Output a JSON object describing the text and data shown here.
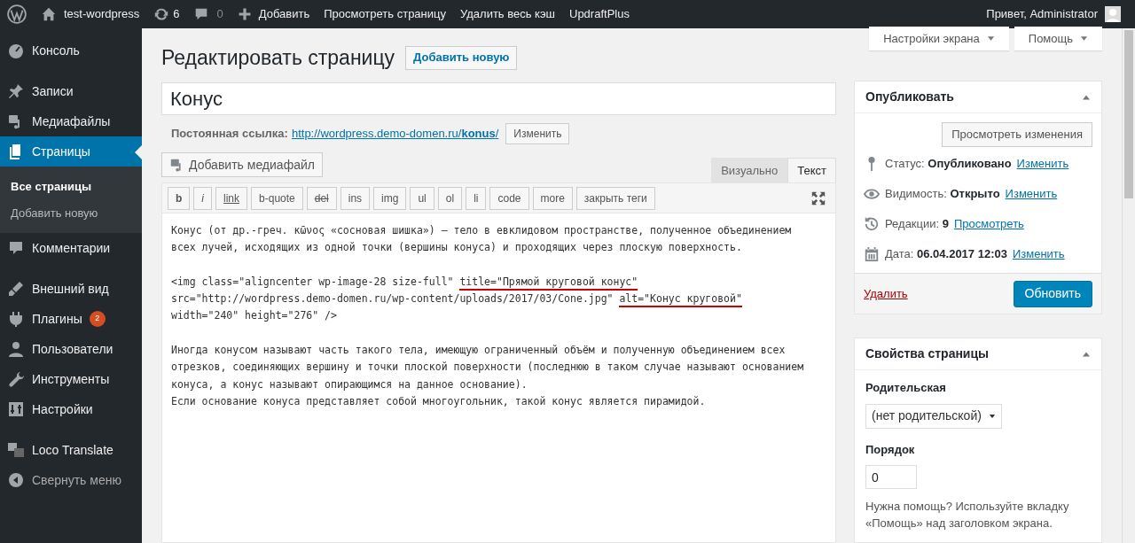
{
  "admin_bar": {
    "site": "test-wordpress",
    "updates": "6",
    "comments": "0",
    "items": [
      "Добавить",
      "Просмотреть страницу",
      "Удалить весь кэш",
      "UpdraftPlus"
    ],
    "greeting": "Привет, Administrator"
  },
  "sidebar": {
    "items": [
      {
        "label": "Консоль",
        "selected": false
      },
      {
        "label": "Записи",
        "selected": false
      },
      {
        "label": "Медиафайлы",
        "selected": false
      },
      {
        "label": "Страницы",
        "selected": true,
        "children": [
          {
            "label": "Все страницы",
            "selected": true
          },
          {
            "label": "Добавить новую",
            "selected": false
          }
        ]
      },
      {
        "label": "Комментарии",
        "selected": false
      },
      {
        "label": "Внешний вид",
        "selected": false
      },
      {
        "label": "Плагины",
        "selected": false,
        "badge": "2"
      },
      {
        "label": "Пользователи",
        "selected": false
      },
      {
        "label": "Инструменты",
        "selected": false
      },
      {
        "label": "Настройки",
        "selected": false
      },
      {
        "label": "Loco Translate",
        "selected": false
      },
      {
        "label": "Свернуть меню",
        "selected": false
      }
    ]
  },
  "screen_meta": [
    "Настройки экрана",
    "Помощь"
  ],
  "heading": {
    "title": "Редактировать страницу",
    "add_new": "Добавить новую"
  },
  "post_title": "Конус",
  "permalink": {
    "label": "Постоянная ссылка:",
    "url_start": "http://wordpress.demo-domen.ru/",
    "slug": "konus",
    "url_end": "/",
    "button": "Изменить"
  },
  "add_media": "Добавить медиафайл",
  "tabs": [
    {
      "label": "Визуально",
      "selected": false
    },
    {
      "label": "Текст",
      "selected": true
    }
  ],
  "quicktags": [
    {
      "label": "b",
      "kind": "bold"
    },
    {
      "label": "i",
      "kind": "italic"
    },
    {
      "label": "link",
      "kind": "underline"
    },
    {
      "label": "b-quote",
      "kind": "plain"
    },
    {
      "label": "del",
      "kind": "strike"
    },
    {
      "label": "ins",
      "kind": "plain"
    },
    {
      "label": "img",
      "kind": "plain"
    },
    {
      "label": "ul",
      "kind": "plain"
    },
    {
      "label": "ol",
      "kind": "plain"
    },
    {
      "label": "li",
      "kind": "plain"
    },
    {
      "label": "code",
      "kind": "plain"
    },
    {
      "label": "more",
      "kind": "plain"
    },
    {
      "label": "закрыть теги",
      "kind": "plain"
    }
  ],
  "editor": {
    "paragraphs": [
      [
        [
          {
            "text": "Конус (от др.-греч. κῶνος «сосновая шишка») — тело в евклидовом пространстве, полученное объединением",
            "marked": false
          }
        ],
        [
          {
            "text": "всех лучей, исходящих из одной точки (вершины конуса) и проходящих через плоскую поверхность.",
            "marked": false
          }
        ]
      ],
      [
        [
          {
            "text": "<img class=\"aligncenter wp-image-28 size-full\" ",
            "marked": false
          },
          {
            "text": "title=\"Прямой круговой конус\"",
            "marked": true
          }
        ],
        [
          {
            "text": "src=\"http://wordpress.demo-domen.ru/wp-content/uploads/2017/03/Cone.jpg\" ",
            "marked": false
          },
          {
            "text": "alt=\"Конус круговой\"",
            "marked": true
          }
        ],
        [
          {
            "text": "width=\"240\" height=\"276\" />",
            "marked": false
          }
        ]
      ],
      [
        [
          {
            "text": "Иногда конусом называют часть такого тела, имеющую ограниченный объём и полученную объединением всех",
            "marked": false
          }
        ],
        [
          {
            "text": "отрезков, соединяющих вершину и точки плоской поверхности (последнюю в таком случае называют основанием",
            "marked": false
          }
        ],
        [
          {
            "text": "конуса, а конус называют опирающимся на данное основание).",
            "marked": false
          }
        ],
        [
          {
            "text": "Если основание конуса представляет собой многоугольник, такой конус является пирамидой.",
            "marked": false
          }
        ]
      ]
    ]
  },
  "publish": {
    "title": "Опубликовать",
    "preview": "Просмотреть изменения",
    "rows": [
      {
        "label": "Статус:",
        "value": "Опубликовано",
        "link": "Изменить"
      },
      {
        "label": "Видимость:",
        "value": "Открыто",
        "link": "Изменить"
      },
      {
        "label": "Редакции:",
        "value": "9",
        "link": "Просмотреть"
      },
      {
        "label": "Дата:",
        "value": "06.04.2017 12:03",
        "link": "Изменить"
      }
    ],
    "delete": "Удалить",
    "update": "Обновить"
  },
  "page_attributes": {
    "title": "Свойства страницы",
    "parent_label": "Родительская",
    "parent_value": "(нет родительской)",
    "order_label": "Порядок",
    "order_value": "0",
    "help": "Нужна помощь? Используйте вкладку «Помощь» над заголовком экрана."
  }
}
